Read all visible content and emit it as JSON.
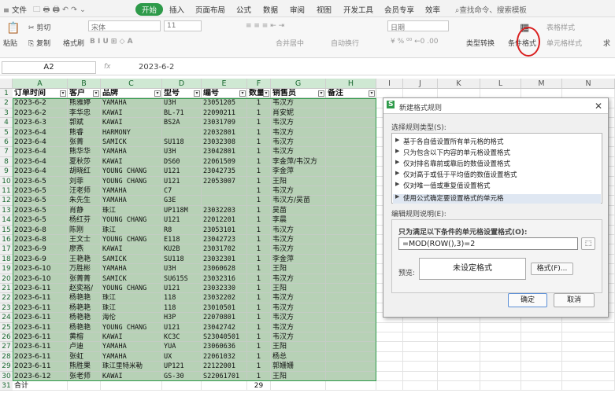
{
  "menu": {
    "file": "文件",
    "tabs": [
      "开始",
      "插入",
      "页面布局",
      "公式",
      "数据",
      "审阅",
      "视图",
      "开发工具",
      "会员专享",
      "效率"
    ],
    "search": "查找命令、搜索模板"
  },
  "ribbon": {
    "paste": "粘贴",
    "cut": "剪切",
    "copy": "复制",
    "format_painter": "格式刷",
    "font_name": "宋体",
    "font_size": "11",
    "merge_center": "合并居中",
    "wrap_text": "自动换行",
    "number_format": "日期",
    "type_convert": "类型转换",
    "conditional_format": "条件格式",
    "table_style": "表格样式",
    "cell_style": "单元格样式",
    "more": "求"
  },
  "formula_bar": {
    "name_box": "A2",
    "fx": "fx",
    "content": "2023-6-2"
  },
  "columns": [
    "A",
    "B",
    "C",
    "D",
    "E",
    "F",
    "G",
    "H",
    "I",
    "J",
    "K",
    "L",
    "M",
    "N"
  ],
  "headers": [
    "订单时间",
    "客户",
    "品牌",
    "型号",
    "编号",
    "数量",
    "销售员",
    "备注"
  ],
  "rows": [
    [
      "2023-6-2",
      "熊雅婷",
      "YAMAHA",
      "U3H",
      "23051205",
      "1",
      "韦汉方"
    ],
    [
      "2023-6-2",
      "李华忠",
      "KAWAI",
      "BL-71",
      "22090211",
      "1",
      "肖安妮"
    ],
    [
      "2023-6-3",
      "郭斌",
      "KAWAI",
      "BS2A",
      "23031709",
      "1",
      "韦汉方"
    ],
    [
      "2023-6-4",
      "熊睿",
      "HARMONY",
      "",
      "22032801",
      "1",
      "韦汉方"
    ],
    [
      "2023-6-4",
      "张菁",
      "SAMICK",
      "SU118",
      "23032308",
      "1",
      "韦汉方"
    ],
    [
      "2023-6-4",
      "熊华华",
      "YAMAHA",
      "U3H",
      "23042801",
      "1",
      "韦汉方"
    ],
    [
      "2023-6-4",
      "夏秋莎",
      "KAWAI",
      "DS60",
      "22061509",
      "1",
      "李金萍/韦汉方"
    ],
    [
      "2023-6-4",
      "胡晓红",
      "YOUNG CHANG",
      "U121",
      "23042735",
      "1",
      "李金萍"
    ],
    [
      "2023-6-5",
      "刘菲",
      "YOUNG CHANG",
      "U121",
      "22053007",
      "1",
      "王阳"
    ],
    [
      "2023-6-5",
      "汪老师",
      "YAMAHA",
      "C7",
      "",
      "1",
      "韦汉方"
    ],
    [
      "2023-6-5",
      "朱先生",
      "YAMAHA",
      "G3E",
      "",
      "1",
      "韦汉方/吴苗"
    ],
    [
      "2023-6-5",
      "肖静",
      "珠江",
      "UP118M",
      "23032203",
      "1",
      "吴苗"
    ],
    [
      "2023-6-5",
      "杨红芬",
      "YOUNG CHANG",
      "U121",
      "22012201",
      "1",
      "李晨"
    ],
    [
      "2023-6-8",
      "陈刚",
      "珠江",
      "R8",
      "23053101",
      "1",
      "韦汉方"
    ],
    [
      "2023-6-8",
      "王文士",
      "YOUNG CHANG",
      "E118",
      "23042723",
      "1",
      "韦汉方"
    ],
    [
      "2023-6-9",
      "廖燕",
      "KAWAI",
      "KU2B",
      "23031702",
      "1",
      "韦汉方"
    ],
    [
      "2023-6-9",
      "王艳艳",
      "SAMICK",
      "SU118",
      "23032301",
      "1",
      "李金萍"
    ],
    [
      "2023-6-10",
      "万胜彬",
      "YAMAHA",
      "U3H",
      "23060628",
      "1",
      "王阳"
    ],
    [
      "2023-6-10",
      "张菁菁",
      "SAMICK",
      "SU615S",
      "23032316",
      "1",
      "韦汉方"
    ],
    [
      "2023-6-11",
      "赵奕裕/",
      "YOUNG CHANG",
      "U121",
      "23032330",
      "1",
      "王阳"
    ],
    [
      "2023-6-11",
      "杨艳艳",
      "珠江",
      "118",
      "23032202",
      "1",
      "韦汉方"
    ],
    [
      "2023-6-11",
      "杨艳艳",
      "珠江",
      "118",
      "23010501",
      "1",
      "韦汉方"
    ],
    [
      "2023-6-11",
      "杨艳艳",
      "海伦",
      "H3P",
      "22070801",
      "1",
      "韦汉方"
    ],
    [
      "2023-6-11",
      "杨艳艳",
      "YOUNG CHANG",
      "U121",
      "23042742",
      "1",
      "韦汉方"
    ],
    [
      "2023-6-11",
      "黄榕",
      "KAWAI",
      "KC3C",
      "S23040501",
      "1",
      "韦汉方"
    ],
    [
      "2023-6-11",
      "卢迪",
      "YAMAHA",
      "YUA",
      "23060636",
      "1",
      "王阳"
    ],
    [
      "2023-6-11",
      "张虹",
      "YAMAHA",
      "UX",
      "22061032",
      "1",
      "杨总"
    ],
    [
      "2023-6-11",
      "熊胜果",
      "珠江里特米勒",
      "UP121",
      "22122001",
      "1",
      "郭姗姗"
    ],
    [
      "2023-6-12",
      "张老师",
      "KAWAI",
      "GS-30",
      "S22061701",
      "1",
      "王阳"
    ]
  ],
  "total_label": "合计",
  "total_value": "29",
  "row_numbers": [
    "1",
    "2",
    "3",
    "4",
    "5",
    "6",
    "7",
    "8",
    "9",
    "10",
    "11",
    "12",
    "13",
    "14",
    "15",
    "16",
    "17",
    "18",
    "19",
    "20",
    "21",
    "22",
    "23",
    "24",
    "25",
    "26",
    "27",
    "28",
    "29",
    "30",
    "31"
  ],
  "dialog": {
    "title": "新建格式规则",
    "select_type_label": "选择规则类型(S):",
    "rule_types": [
      "基于各自值设置所有单元格的格式",
      "只为包含以下内容的单元格设置格式",
      "仅对排名靠前或靠后的数值设置格式",
      "仅对高于或低于平均值的数值设置格式",
      "仅对唯一值或重复值设置格式",
      "使用公式确定要设置格式的单元格"
    ],
    "edit_desc_label": "编辑规则说明(E):",
    "formula_label": "只为满足以下条件的单元格设置格式(O):",
    "formula": "=MOD(ROW(),3)=2",
    "preview_label": "预览:",
    "preview_text": "未设定格式",
    "format_btn": "格式(F)...",
    "ok": "确定",
    "cancel": "取消"
  },
  "colors": {
    "accent": "#2e9a4a",
    "band": "#b7d1b6",
    "highlight": "#d92020"
  }
}
